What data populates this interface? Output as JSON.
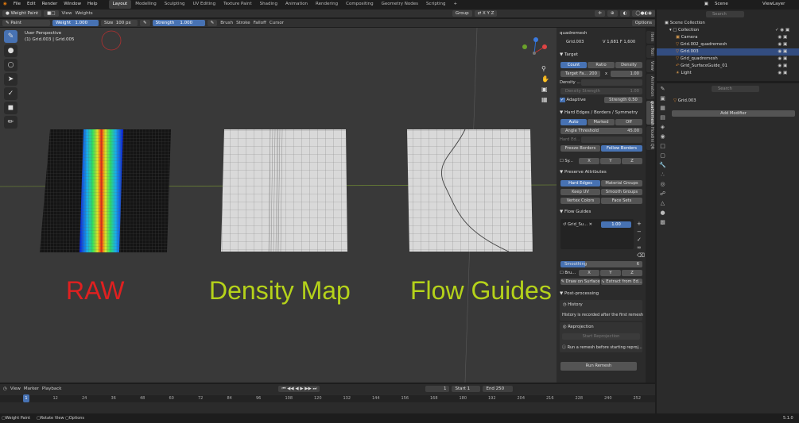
{
  "topbar": {
    "menus": [
      "File",
      "Edit",
      "Render",
      "Window",
      "Help"
    ],
    "workspaces": [
      "Layout",
      "Modelling",
      "Sculpting",
      "UV Editing",
      "Texture Paint",
      "Shading",
      "Animation",
      "Rendering",
      "Compositing",
      "Geometry Nodes",
      "Scripting",
      "+"
    ],
    "scene": "Scene",
    "view_layer": "ViewLayer"
  },
  "header": {
    "mode": "Weight Paint",
    "view": "View",
    "weights": "Weights",
    "group": "Group",
    "brush_name": "Paint",
    "weight_label": "Weight",
    "weight_value": "1.000",
    "size_label": "Size",
    "size_value": "100 px",
    "strength_label": "Strength",
    "strength_value": "1.000",
    "brush": "Brush",
    "stroke": "Stroke",
    "falloff": "Falloff",
    "cursor": "Cursor",
    "options": "Options"
  },
  "viewport": {
    "perspective": "User Perspective",
    "object": "(1) Grid.003 | Grid.005",
    "labels": {
      "raw": "RAW",
      "density": "Density Map",
      "flow": "Flow Guides"
    },
    "colors": {
      "raw": "#e02020",
      "label": "#b5d21a"
    }
  },
  "npanel": {
    "title": "quadremesh",
    "object": "Grid.003",
    "stats": "V 1,681  F 1,600",
    "target": "Target",
    "count": "Count",
    "ratio": "Ratio",
    "density": "Density",
    "target_faces_label": "Target Fa...",
    "target_faces": "200",
    "x": "x",
    "ratio_value": "1.00",
    "density_label": "Density ...",
    "density_strength": "Density Strength",
    "density_strength_value": "1.00",
    "adaptive": "Adaptive",
    "strength": "Strength",
    "strength_value": "0.50",
    "hard_edges_title": "Hard Edges / Borders / Symmetry",
    "auto": "Auto",
    "marked": "Marked",
    "off": "Off",
    "angle_label": "Angle Threshold",
    "angle_value": "45.00",
    "hard_ed": "Hard Ed...",
    "freeze": "Freeze Borders",
    "follow": "Follow Borders",
    "sym": "Sy...",
    "sx": "X",
    "sy": "Y",
    "sz": "Z",
    "preserve_title": "Preserve Attributes",
    "hard_edges": "Hard Edges",
    "material_groups": "Material Groups",
    "keep_uv": "Keep UV",
    "smooth_groups": "Smooth Groups",
    "vertex_colors": "Vertex Colors",
    "face_sets": "Face Sets",
    "flow_title": "Flow Guides",
    "flow_item": "Grid_Su...",
    "flow_value": "1.00",
    "smoothing": "Smoothing",
    "smoothing_value": "6",
    "bru": "Bru...",
    "bx": "X",
    "by": "Y",
    "bz": "Z",
    "draw_on_surface": "Draw on Surface",
    "extract": "Extract from Ed...",
    "post_title": "Post-processing",
    "history": "History",
    "history_note": "History is recorded after the first remesh",
    "reprojection": "Reprojection",
    "start_reproj": "Start Reprojection",
    "reproj_note": "Run a remesh before starting reproj...",
    "run_remesh": "Run Remesh"
  },
  "tabs": [
    "Item",
    "Tool",
    "View",
    "Animation",
    "quadremesh",
    "Houdini QR"
  ],
  "outliner": {
    "search_placeholder": "Search",
    "title": "Scene Collection",
    "items": [
      "Collection",
      "Camera",
      "Grid.002_quadremesh",
      "Grid.003",
      "Grid_quadremesh",
      "Grid_SurfaceGuide_01",
      "Light"
    ]
  },
  "props": {
    "search_placeholder": "Search",
    "object": "Grid.003",
    "add_modifier": "Add Modifier"
  },
  "timeline": {
    "playback": "Playback",
    "view": "View",
    "marker": "Marker",
    "current": "1",
    "start_label": "Start",
    "start": "1",
    "end_label": "End",
    "end": "250",
    "ticks": [
      "0",
      "12",
      "24",
      "36",
      "48",
      "60",
      "72",
      "84",
      "96",
      "108",
      "120",
      "132",
      "144",
      "156",
      "168",
      "180",
      "192",
      "204",
      "216",
      "228",
      "240",
      "252"
    ]
  },
  "status": {
    "left": "Weight Paint",
    "rotate": "Rotate View",
    "options": "Options",
    "version": "5.1.0"
  }
}
